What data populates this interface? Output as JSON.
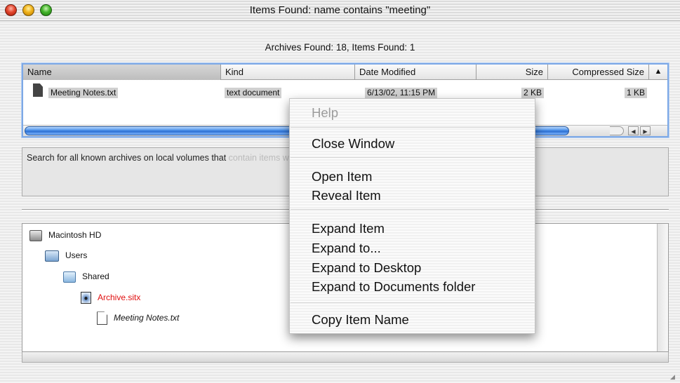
{
  "window": {
    "title": "Items Found: name contains \"meeting\""
  },
  "summary": "Archives Found: 18, Items Found: 1",
  "results": {
    "columns": {
      "name": "Name",
      "kind": "Kind",
      "date": "Date Modified",
      "size": "Size",
      "compressed": "Compressed Size",
      "sort_indicator": "▲"
    },
    "rows": [
      {
        "name": "Meeting Notes.txt",
        "kind": "text document",
        "date": "6/13/02, 11:15 PM",
        "size": "2 KB",
        "compressed": "1 KB"
      }
    ]
  },
  "scrollbar": {
    "left_arrow": "◀",
    "right_arrow": "▶"
  },
  "description": {
    "text": "Search for all known archives on local volumes that ",
    "faded": "contain items whose name contains \"meeting\""
  },
  "tree": {
    "nodes": [
      {
        "label": "Macintosh HD",
        "icon": "hard-disk-icon"
      },
      {
        "label": "Users",
        "icon": "users-folder-icon"
      },
      {
        "label": "Shared",
        "icon": "folder-icon"
      },
      {
        "label": "Archive.sitx",
        "icon": "archive-icon",
        "color": "#e01010"
      },
      {
        "label": "Meeting Notes.txt",
        "icon": "document-icon"
      }
    ]
  },
  "context_menu": {
    "help": "Help",
    "close_window": "Close Window",
    "open_item": "Open Item",
    "reveal_item": "Reveal Item",
    "expand_item": "Expand Item",
    "expand_to": "Expand to...",
    "expand_desktop": "Expand to Desktop",
    "expand_documents": "Expand to Documents folder",
    "copy_name": "Copy Item Name"
  },
  "colors": {
    "focus_ring": "#7da9e6",
    "scroll_thumb": "#2a6ed2",
    "archive_text": "#e01010"
  }
}
